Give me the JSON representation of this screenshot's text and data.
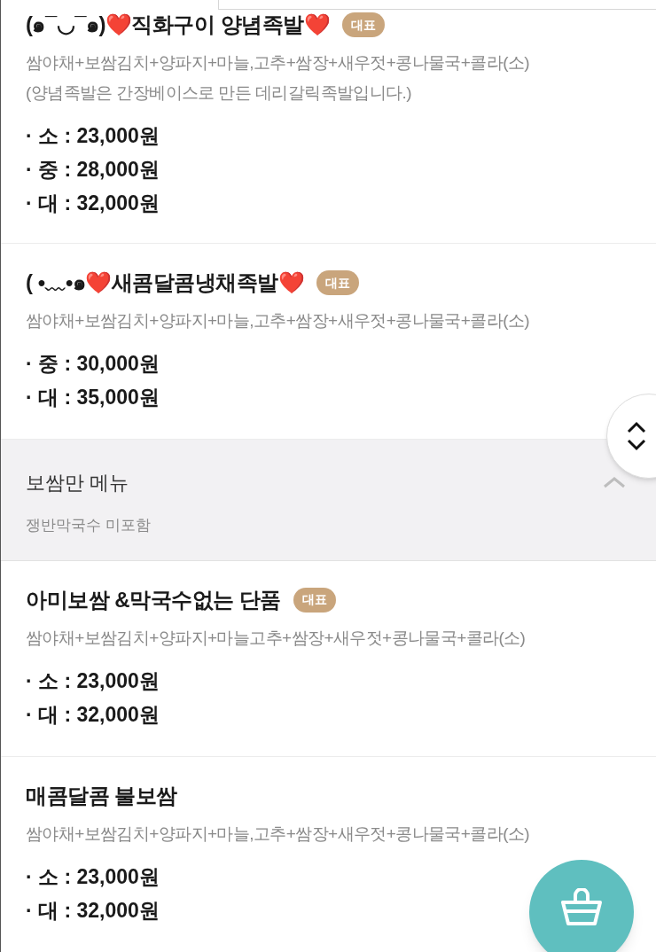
{
  "menu": [
    {
      "kind": "item",
      "title": "(๑¯◡¯๑)❤️직화구이 양념족발❤️",
      "badge": "대표",
      "description": [
        "쌈야채+보쌈김치+양파지+마늘,고추+쌈장+새우젓+콩나물국+콜라(소)",
        "(양념족발은 간장베이스로 만든 데리갈릭족발입니다.)"
      ],
      "prices": [
        "· 소 : 23,000원",
        "· 중 : 28,000원",
        "· 대 : 32,000원"
      ]
    },
    {
      "kind": "item",
      "title": "( •﹏•๑❤️새콤달콤냉채족발❤️",
      "badge": "대표",
      "description": [
        "쌈야채+보쌈김치+양파지+마늘,고추+쌈장+새우젓+콩나물국+콜라(소)"
      ],
      "prices": [
        "· 중 : 30,000원",
        "· 대 : 35,000원"
      ]
    },
    {
      "kind": "section",
      "title": "보쌈만 메뉴",
      "subtitle": "쟁반막국수 미포함",
      "expanded": true
    },
    {
      "kind": "item",
      "title": "아미보쌈 &막국수없는 단품",
      "badge": "대표",
      "description": [
        "쌈야채+보쌈김치+양파지+마늘고추+쌈장+새우젓+콩나물국+콜라(소)"
      ],
      "prices": [
        "· 소 : 23,000원",
        "· 대 : 32,000원"
      ]
    },
    {
      "kind": "item",
      "title": "매콤달콤 불보쌈",
      "description": [
        "쌈야채+보쌈김치+양파지+마늘,고추+쌈장+새우젓+콩나물국+콜라(소)"
      ],
      "prices": [
        "· 소 : 23,000원",
        "· 대 : 32,000원"
      ]
    }
  ]
}
